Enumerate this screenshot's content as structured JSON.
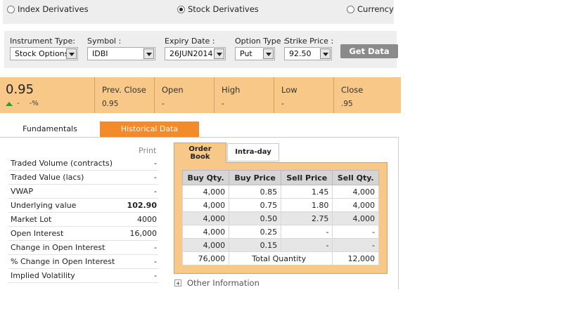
{
  "segments": [
    {
      "label": "Index Derivatives",
      "checked": false
    },
    {
      "label": "Stock Derivatives",
      "checked": true
    },
    {
      "label": "Currency",
      "checked": false
    }
  ],
  "filters": {
    "instrument_type": {
      "label": "Instrument Type:",
      "value": "Stock Options"
    },
    "symbol": {
      "label": "Symbol :",
      "value": "IDBI"
    },
    "expiry_date": {
      "label": "Expiry Date :",
      "value": "26JUN2014"
    },
    "option_type": {
      "label": "Option Type :",
      "value": "Put"
    },
    "strike_price": {
      "label": "Strike Price :",
      "value": "92.50"
    },
    "get_data_label": "Get Data"
  },
  "quote": {
    "ltp": "0.95",
    "change": "-",
    "pct_change": "-%",
    "columns": [
      {
        "label": "Prev. Close",
        "value": "0.95"
      },
      {
        "label": "Open",
        "value": "-"
      },
      {
        "label": "High",
        "value": "-"
      },
      {
        "label": "Low",
        "value": "-"
      },
      {
        "label": "Close",
        "value": ".95"
      }
    ]
  },
  "tabs": {
    "fundamentals": "Fundamentals",
    "historical": "Historical Data"
  },
  "fundamentals": {
    "print_label": "Print",
    "rows": [
      {
        "key": "Traded Volume (contracts)",
        "value": "-"
      },
      {
        "key": "Traded Value (lacs)",
        "value": "-"
      },
      {
        "key": "VWAP",
        "value": "-"
      },
      {
        "key": "Underlying value",
        "value": "102.90"
      },
      {
        "key": "Market Lot",
        "value": "4000"
      },
      {
        "key": "Open Interest",
        "value": "16,000"
      },
      {
        "key": "Change in Open Interest",
        "value": "-"
      },
      {
        "key": "% Change in Open Interest",
        "value": "-"
      },
      {
        "key": "Implied Volatility",
        "value": "-"
      }
    ]
  },
  "order_book": {
    "tab_order_book": "Order Book",
    "tab_intraday": "Intra-day",
    "headers": [
      "Buy Qty.",
      "Buy Price",
      "Sell Price",
      "Sell Qty."
    ],
    "rows": [
      [
        "4,000",
        "0.85",
        "1.45",
        "4,000"
      ],
      [
        "4,000",
        "0.75",
        "1.80",
        "4,000"
      ],
      [
        "4,000",
        "0.50",
        "2.75",
        "4,000"
      ],
      [
        "4,000",
        "0.25",
        "-",
        "-"
      ],
      [
        "4,000",
        "0.15",
        "-",
        "-"
      ]
    ],
    "total_buy": "76,000",
    "total_label": "Total Quantity",
    "total_sell": "12,000"
  },
  "other_info_label": "Other Information",
  "colors": {
    "quote_bg": "#f7c887",
    "active_tab": "#f38b2a",
    "up_arrow": "#2e9a2e"
  }
}
